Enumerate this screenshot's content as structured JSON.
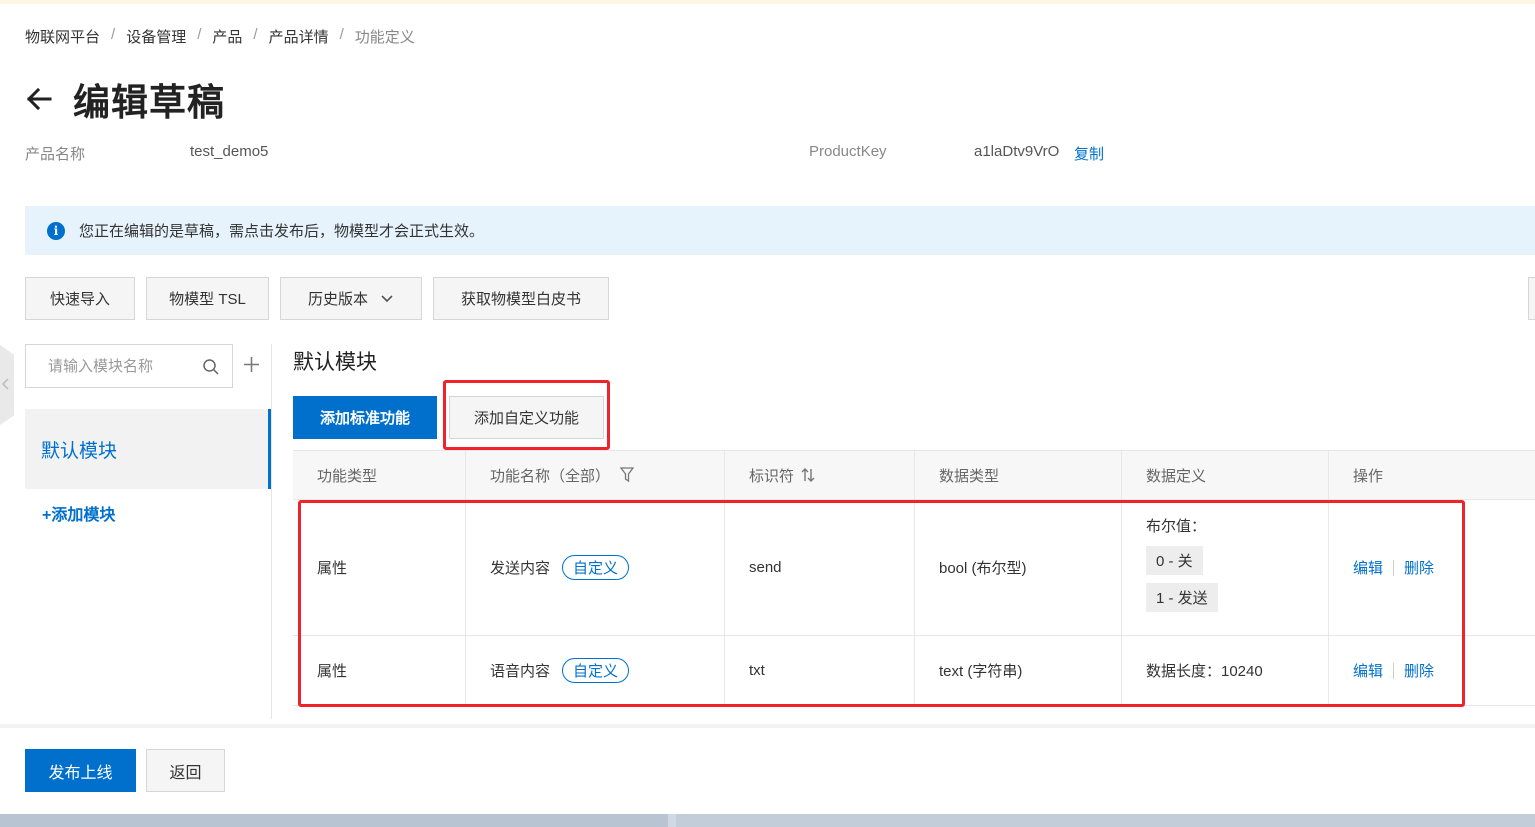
{
  "breadcrumb": [
    "物联网平台",
    "设备管理",
    "产品",
    "产品详情",
    "功能定义"
  ],
  "page": {
    "title": "编辑草稿"
  },
  "product": {
    "name_label": "产品名称",
    "name_value": "test_demo5",
    "key_label": "ProductKey",
    "key_value": "a1laDtv9VrO",
    "copy_label": "复制"
  },
  "notice": {
    "icon": "info-icon",
    "text": "您正在编辑的是草稿，需点击发布后，物模型才会正式生效。"
  },
  "toolbar": {
    "quick_import": "快速导入",
    "tsl": "物模型 TSL",
    "history": "历史版本",
    "whitepaper": "获取物模型白皮书"
  },
  "sidebar": {
    "search_placeholder": "请输入模块名称",
    "module_default": "默认模块",
    "add_module": "+添加模块"
  },
  "main": {
    "module_title": "默认模块",
    "add_standard": "添加标准功能",
    "add_custom": "添加自定义功能"
  },
  "table": {
    "headers": [
      "功能类型",
      "功能名称（全部）",
      "标识符",
      "数据类型",
      "数据定义",
      "操作"
    ],
    "rows": [
      {
        "type": "属性",
        "name": "发送内容",
        "tag": "自定义",
        "identifier": "send",
        "data_type": "bool (布尔型)",
        "definition_title": "布尔值：",
        "definition_items": [
          "0 - 关",
          "1 - 发送"
        ],
        "edit": "编辑",
        "delete": "删除"
      },
      {
        "type": "属性",
        "name": "语音内容",
        "tag": "自定义",
        "identifier": "txt",
        "data_type": "text (字符串)",
        "definition_text": "数据长度：10240",
        "edit": "编辑",
        "delete": "删除"
      }
    ]
  },
  "footer": {
    "publish": "发布上线",
    "back": "返回"
  },
  "colors": {
    "primary": "#0070cc",
    "highlight": "#f0222a",
    "notice_bg": "#e6f3fc"
  }
}
